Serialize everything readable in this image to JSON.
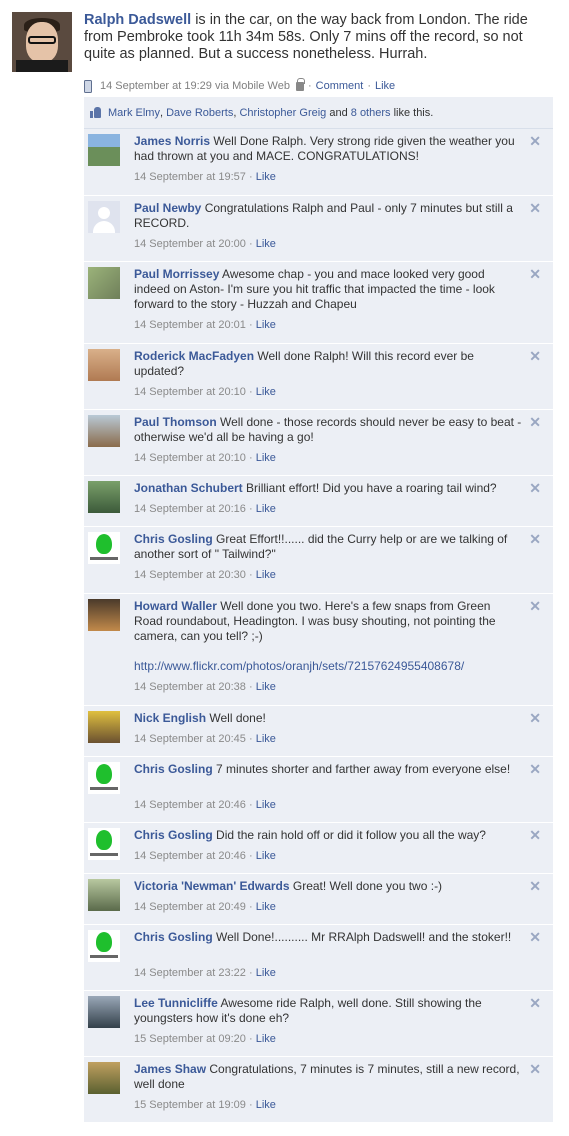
{
  "post": {
    "author": "Ralph Dadswell",
    "text": " is in the car, on the way back from London. The ride from Pembroke took 11h 34m 58s. Only 7 mins off the record, so not quite as planned. But a success nonetheless. Hurrah.",
    "timestamp": "14 September at 19:29 via Mobile Web",
    "comment_label": "Comment",
    "like_label": "Like"
  },
  "likes": {
    "name1": "Mark Elmy",
    "name2": "Dave Roberts",
    "name3": "Christopher Greig",
    "and": " and ",
    "others": "8 others",
    "suffix": " like this."
  },
  "comments": [
    {
      "name": "James Norris",
      "text": " Well Done Ralph. Very strong ride given the weather you had thrown at you and MACE. CONGRATULATIONS!",
      "time": "14 September at 19:57",
      "like": "Like"
    },
    {
      "name": "Paul Newby",
      "text": " Congratulations Ralph and Paul - only 7 minutes but still a RECORD.",
      "time": "14 September at 20:00",
      "like": "Like"
    },
    {
      "name": "Paul Morrissey",
      "text": " Awesome chap - you and mace looked very good indeed on Aston- I'm sure you hit traffic that impacted the time - look forward to the story - Huzzah and Chapeu",
      "time": "14 September at 20:01",
      "like": "Like"
    },
    {
      "name": "Roderick MacFadyen",
      "text": " Well done Ralph! Will this record ever be updated?",
      "time": "14 September at 20:10",
      "like": "Like"
    },
    {
      "name": "Paul Thomson",
      "text": " Well done - those records should never be easy to beat - otherwise we'd all be having a go!",
      "time": "14 September at 20:10",
      "like": "Like"
    },
    {
      "name": "Jonathan Schubert",
      "text": " Brilliant effort! Did you have a roaring tail wind?",
      "time": "14 September at 20:16",
      "like": "Like"
    },
    {
      "name": "Chris Gosling",
      "text": " Great Effort!!...... did the Curry help or are we talking of another sort of \" Tailwind?\"",
      "time": "14 September at 20:30",
      "like": "Like"
    },
    {
      "name": "Howard Waller",
      "text": " Well done you two. Here's a few snaps from Green Road roundabout, Headington. I was busy shouting, not pointing the camera, can you tell? ;-)",
      "url": "http://www.flickr.com/photos/oranjh/sets/72157624955408678/",
      "time": "14 September at 20:38",
      "like": "Like"
    },
    {
      "name": "Nick English",
      "text": " Well done!",
      "time": "14 September at 20:45",
      "like": "Like"
    },
    {
      "name": "Chris Gosling",
      "text": " 7 minutes shorter and farther away from everyone else!",
      "time": "14 September at 20:46",
      "like": "Like"
    },
    {
      "name": "Chris Gosling",
      "text": " Did the rain hold off or did it follow you all the way?",
      "time": "14 September at 20:46",
      "like": "Like"
    },
    {
      "name": "Victoria 'Newman' Edwards",
      "text": " Great! Well done you two :-)",
      "time": "14 September at 20:49",
      "like": "Like"
    },
    {
      "name": "Chris Gosling",
      "text": " Well Done!.......... Mr RRAlph Dadswell! and the stoker!!",
      "time": "14 September at 23:22",
      "like": "Like"
    },
    {
      "name": "Lee Tunnicliffe",
      "text": " Awesome ride Ralph, well done. Still showing the youngsters how it's done eh?",
      "time": "15 September at 09:20",
      "like": "Like"
    },
    {
      "name": "James Shaw",
      "text": " Congratulations, 7 minutes is 7 minutes, still a new record, well done",
      "time": "15 September at 19:09",
      "like": "Like"
    }
  ],
  "close_glyph": "✕"
}
